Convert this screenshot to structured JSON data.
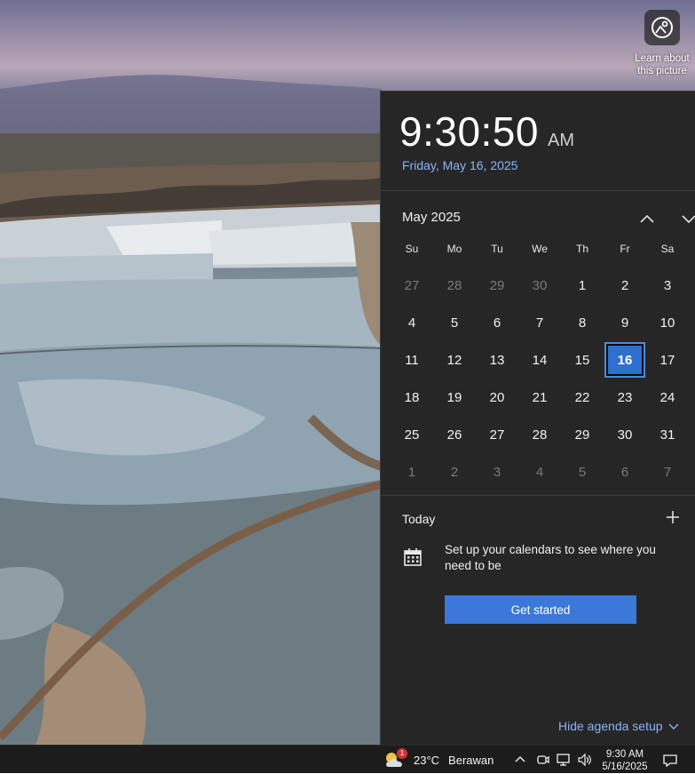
{
  "learn_picture": {
    "label_line1": "Learn about",
    "label_line2": "this picture"
  },
  "clock": {
    "time": "9:30:50",
    "ampm": "AM",
    "date": "Friday, May 16, 2025"
  },
  "calendar": {
    "month_label": "May 2025",
    "weekdays": [
      "Su",
      "Mo",
      "Tu",
      "We",
      "Th",
      "Fr",
      "Sa"
    ],
    "weeks": [
      [
        "27",
        "28",
        "29",
        "30",
        "1",
        "2",
        "3"
      ],
      [
        "4",
        "5",
        "6",
        "7",
        "8",
        "9",
        "10"
      ],
      [
        "11",
        "12",
        "13",
        "14",
        "15",
        "16",
        "17"
      ],
      [
        "18",
        "19",
        "20",
        "21",
        "22",
        "23",
        "24"
      ],
      [
        "25",
        "26",
        "27",
        "28",
        "29",
        "30",
        "31"
      ],
      [
        "1",
        "2",
        "3",
        "4",
        "5",
        "6",
        "7"
      ]
    ],
    "today": "16",
    "accent": "#2f6fd0"
  },
  "agenda": {
    "today_label": "Today",
    "setup_text": "Set up your calendars to see where you need to be",
    "get_started_label": "Get started",
    "hide_label": "Hide agenda setup"
  },
  "taskbar": {
    "weather_badge": "1",
    "temperature": "23°C",
    "condition": "Berawan",
    "time": "9:30 AM",
    "date": "5/16/2025"
  },
  "colors": {
    "link": "#8ab4f8",
    "button": "#3b78d8",
    "flyout_bg": "#262626"
  }
}
